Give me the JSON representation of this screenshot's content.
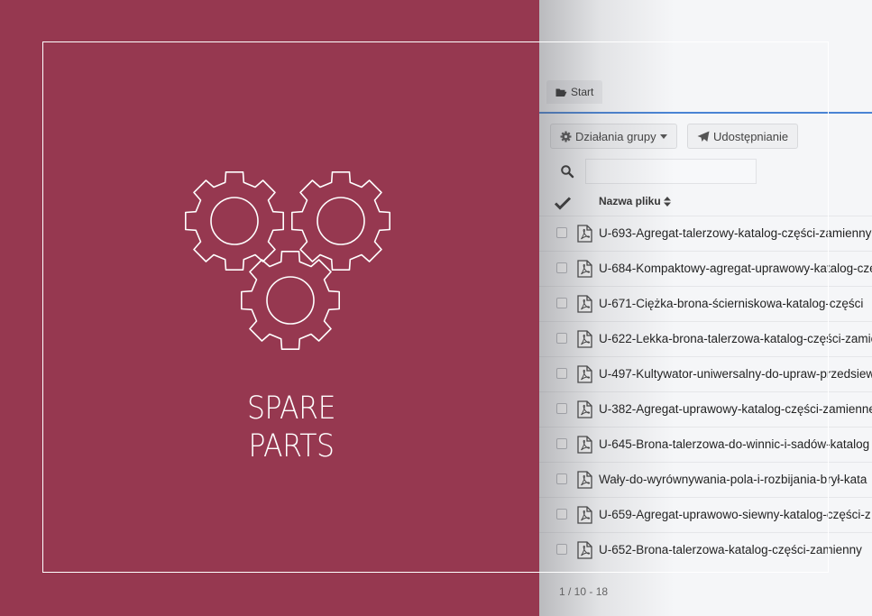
{
  "banner": {
    "title_line1": "SPARE",
    "title_line2": "PARTS",
    "background_color": "#963850",
    "icon": "gears-icon"
  },
  "file_browser": {
    "tab_start_label": "Start",
    "tab_start_icon": "folder-open-icon",
    "group_actions_label": "Działania grupy",
    "share_label": "Udostępnianie",
    "search_placeholder": "",
    "column_header": "Nazwa pliku",
    "files": [
      {
        "name": "U-693-Agregat-talerzowy-katalog-części-zamienny"
      },
      {
        "name": "U-684-Kompaktowy-agregat-uprawowy-katalog-częś"
      },
      {
        "name": "U-671-Ciężka-brona-ścierniskowa-katalog-części"
      },
      {
        "name": "U-622-Lekka-brona-talerzowa-katalog-części-zamie"
      },
      {
        "name": "U-497-Kultywator-uniwersalny-do-upraw-przedsiew"
      },
      {
        "name": "U-382-Agregat-uprawowy-katalog-części-zamienne"
      },
      {
        "name": "U-645-Brona-talerzowa-do-winnic-i-sadów-katalog"
      },
      {
        "name": "Wały-do-wyrównywania-pola-i-rozbijania-brył-kata"
      },
      {
        "name": "U-659-Agregat-uprawowo-siewny-katalog-części-z"
      },
      {
        "name": "U-652-Brona-talerzowa-katalog-części-zamienny"
      }
    ],
    "pagination": "1 / 10 - 18",
    "accent_color": "#4a84d4"
  }
}
